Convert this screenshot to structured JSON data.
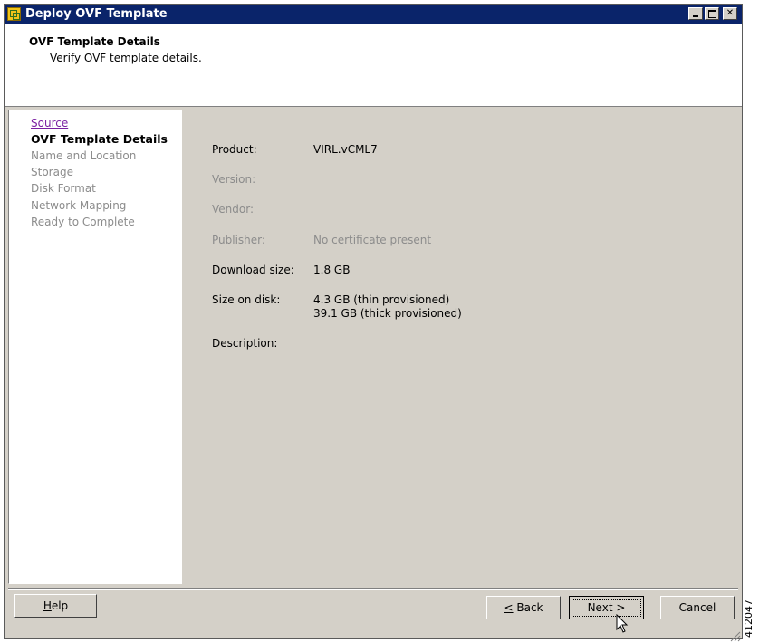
{
  "window": {
    "title": "Deploy OVF Template",
    "icon": "vsphere-app-icon",
    "controls": [
      "minimize",
      "maximize",
      "close"
    ]
  },
  "header": {
    "title": "OVF Template Details",
    "subtitle": "Verify OVF template details."
  },
  "steps": [
    {
      "label": "Source",
      "state": "visited"
    },
    {
      "label": "OVF Template Details",
      "state": "current"
    },
    {
      "label": "Name and Location",
      "state": "pending"
    },
    {
      "label": "Storage",
      "state": "pending"
    },
    {
      "label": "Disk Format",
      "state": "pending"
    },
    {
      "label": "Network Mapping",
      "state": "pending"
    },
    {
      "label": "Ready to Complete",
      "state": "pending"
    }
  ],
  "details": {
    "product_label": "Product:",
    "product_value": "VIRL.vCML7",
    "version_label": "Version:",
    "vendor_label": "Vendor:",
    "publisher_label": "Publisher:",
    "publisher_value": "No certificate present",
    "download_label": "Download size:",
    "download_value": "1.8 GB",
    "disk_label": "Size on disk:",
    "disk_thin": "4.3 GB (thin provisioned)",
    "disk_thick": "39.1 GB (thick provisioned)",
    "description_label": "Description:"
  },
  "buttons": {
    "help_mnemonic": "H",
    "help_rest": "elp",
    "back_mnemonic": "<",
    "back_rest": " Back",
    "next": "Next >",
    "cancel": "Cancel"
  },
  "figure_number": "412047",
  "colors": {
    "titlebar": "#0a246a",
    "dialog_face": "#d4d0c8",
    "visited_link": "#7a1fa2",
    "disabled_text": "#8c8c8c"
  }
}
